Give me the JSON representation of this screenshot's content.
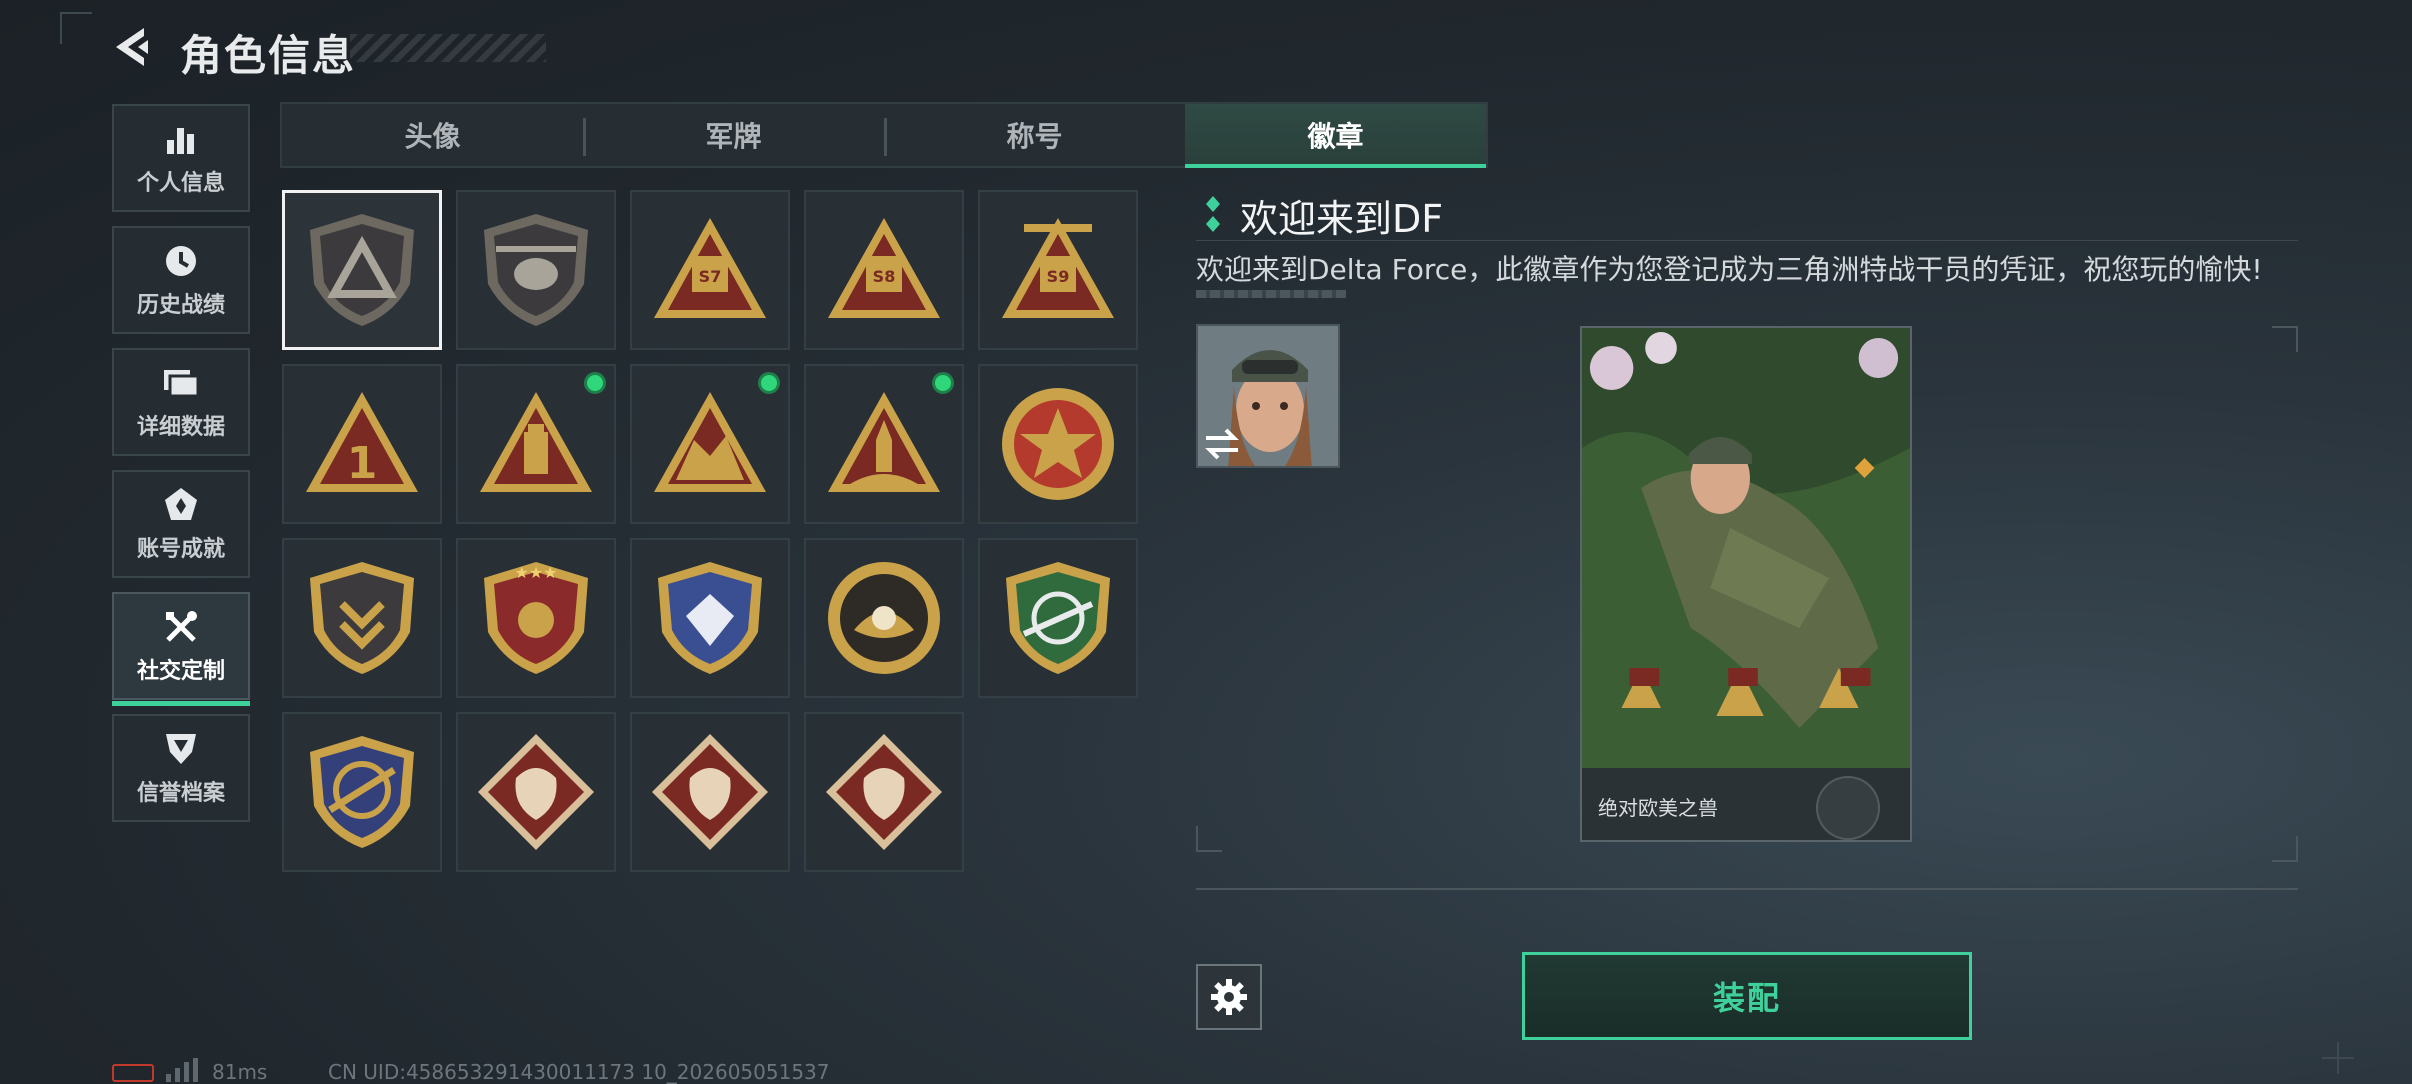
{
  "header": {
    "title": "角色信息"
  },
  "sidebar": {
    "items": [
      {
        "label": "个人信息",
        "icon": "bar-chart-icon",
        "active": false
      },
      {
        "label": "历史战绩",
        "icon": "history-clock-icon",
        "active": false
      },
      {
        "label": "详细数据",
        "icon": "folder-icon",
        "active": false
      },
      {
        "label": "账号成就",
        "icon": "achievement-icon",
        "active": false
      },
      {
        "label": "社交定制",
        "icon": "tools-icon",
        "active": true
      },
      {
        "label": "信誉档案",
        "icon": "reputation-icon",
        "active": false
      }
    ]
  },
  "tabs": [
    {
      "label": "头像",
      "active": false
    },
    {
      "label": "军牌",
      "active": false
    },
    {
      "label": "称号",
      "active": false
    },
    {
      "label": "徽章",
      "active": true
    }
  ],
  "badges": [
    {
      "id": "df-welcome",
      "shape": "shield-triangle",
      "selected": true,
      "new": false
    },
    {
      "id": "helicopter",
      "shape": "shield-heli",
      "selected": false,
      "new": false
    },
    {
      "id": "s7",
      "shape": "triangle",
      "text": "S7",
      "selected": false,
      "new": false
    },
    {
      "id": "s8",
      "shape": "triangle",
      "text": "S8",
      "selected": false,
      "new": false
    },
    {
      "id": "s9",
      "shape": "triangle-wings",
      "text": "S9",
      "selected": false,
      "new": false
    },
    {
      "id": "rank-1",
      "shape": "triangle",
      "text": "1",
      "selected": false,
      "new": false
    },
    {
      "id": "usb",
      "shape": "triangle-usb",
      "selected": false,
      "new": true
    },
    {
      "id": "soldiers",
      "shape": "triangle-soldiers",
      "selected": false,
      "new": true
    },
    {
      "id": "rocket",
      "shape": "triangle-rocket",
      "selected": false,
      "new": true
    },
    {
      "id": "star-medal",
      "shape": "round-star",
      "selected": false,
      "new": false
    },
    {
      "id": "chevron-shield",
      "shape": "shield-gold",
      "selected": false,
      "new": false
    },
    {
      "id": "three-star-shield",
      "shape": "shield-red-stars",
      "selected": false,
      "new": false
    },
    {
      "id": "diamond-shield",
      "shape": "shield-blue",
      "selected": false,
      "new": false
    },
    {
      "id": "pearl",
      "shape": "round-pearl",
      "selected": false,
      "new": false
    },
    {
      "id": "sniper",
      "shape": "shield-green",
      "selected": false,
      "new": false
    },
    {
      "id": "rifle-shield",
      "shape": "shield-navy",
      "selected": false,
      "new": false
    },
    {
      "id": "wolf",
      "shape": "diamond-wolf",
      "selected": false,
      "new": false
    },
    {
      "id": "dragon",
      "shape": "diamond-dragon",
      "selected": false,
      "new": false
    },
    {
      "id": "runner",
      "shape": "diamond-runner",
      "selected": false,
      "new": false
    }
  ],
  "detail": {
    "name": "欢迎来到DF",
    "description": "欢迎来到Delta Force，此徽章作为您登记成为三角洲特战干员的凭证，祝您玩的愉快!",
    "card_label": "绝对欧美之兽"
  },
  "actions": {
    "equip_label": "装配"
  },
  "status": {
    "ping": "81ms",
    "uid": "CN UID:458653291430011173 10_202605051537"
  },
  "colors": {
    "accent": "#3fd19b",
    "new_dot": "#2fd77a",
    "gold": "#c9a24a",
    "badge_red": "#7a2a22"
  }
}
